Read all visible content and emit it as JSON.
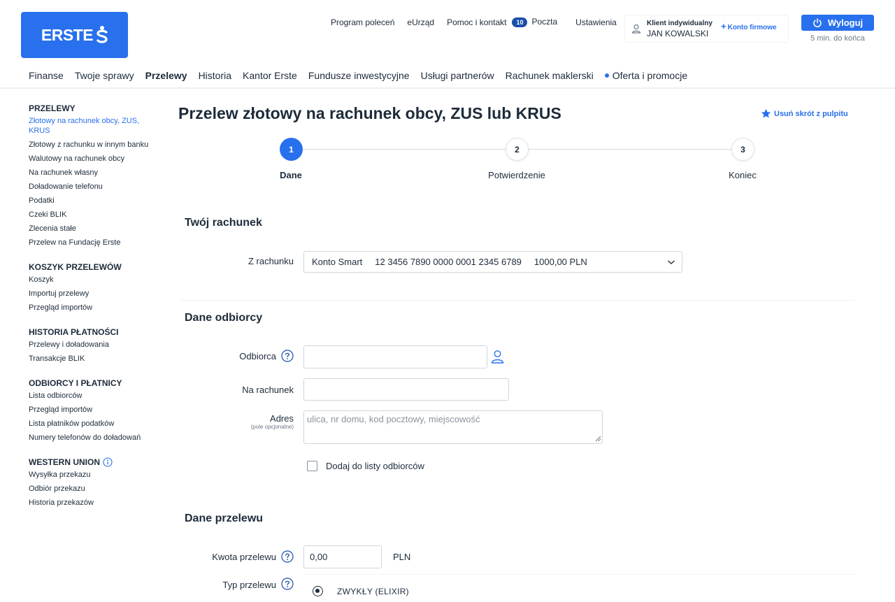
{
  "brand": {
    "name": "ERSTE",
    "color": "#2870ed"
  },
  "top_links": [
    {
      "label": "Program poleceń"
    },
    {
      "label": "eUrząd"
    },
    {
      "label": "Pomoc i kontakt"
    },
    {
      "label": "Poczta",
      "badge": "10"
    },
    {
      "label": "Ustawienia"
    }
  ],
  "client": {
    "type": "Klient indywidualny",
    "name": "JAN KOWALSKI",
    "business_link": "Konto firmowe"
  },
  "logout": {
    "label": "Wyloguj",
    "session_text": "5 min. do końca"
  },
  "main_nav": [
    {
      "label": "Finanse",
      "active": false
    },
    {
      "label": "Twoje sprawy",
      "active": false
    },
    {
      "label": "Przelewy",
      "active": true
    },
    {
      "label": "Historia",
      "active": false
    },
    {
      "label": "Kantor Erste",
      "active": false
    },
    {
      "label": "Fundusze inwestycyjne",
      "active": false
    },
    {
      "label": "Usługi partnerów",
      "active": false
    },
    {
      "label": "Rachunek maklerski",
      "active": false
    },
    {
      "label": "Oferta i promocje",
      "active": false
    }
  ],
  "sidebar": {
    "groups": [
      {
        "title": "PRZELEWY",
        "items": [
          {
            "label": "Złotowy na rachunek obcy, ZUS, KRUS",
            "active": true
          },
          {
            "label": "Złotowy z rachunku w innym banku"
          },
          {
            "label": "Walutowy na rachunek obcy"
          },
          {
            "label": "Na rachunek własny"
          },
          {
            "label": "Doładowanie telefonu"
          },
          {
            "label": "Podatki"
          },
          {
            "label": "Czeki BLIK"
          },
          {
            "label": "Zlecenia stałe"
          },
          {
            "label": "Przelew na Fundację Erste"
          }
        ]
      },
      {
        "title": "KOSZYK PRZELEWÓW",
        "items": [
          {
            "label": "Koszyk"
          },
          {
            "label": "Importuj przelewy"
          },
          {
            "label": "Przegląd importów"
          }
        ]
      },
      {
        "title": "HISTORIA PŁATNOŚCI",
        "items": [
          {
            "label": "Przelewy i doładowania"
          },
          {
            "label": "Transakcje BLIK"
          }
        ]
      },
      {
        "title": "ODBIORCY I PŁATNICY",
        "items": [
          {
            "label": "Lista odbiorców"
          },
          {
            "label": "Przegląd importów"
          },
          {
            "label": "Lista płatników podatków"
          },
          {
            "label": "Numery telefonów do doładowań"
          }
        ]
      },
      {
        "title": "WESTERN UNION",
        "info_icon": "info-circle-icon",
        "items": [
          {
            "label": "Wysyłka przekazu"
          },
          {
            "label": "Odbiór przekazu"
          },
          {
            "label": "Historia przekazów"
          }
        ]
      }
    ]
  },
  "page": {
    "title": "Przelew złotowy na rachunek obcy, ZUS lub KRUS",
    "shortcut_label": "Usuń skrót z pulpitu"
  },
  "stepper": [
    {
      "number": "1",
      "label": "Dane",
      "active": true
    },
    {
      "number": "2",
      "label": "Potwierdzenie",
      "active": false
    },
    {
      "number": "3",
      "label": "Koniec",
      "active": false
    }
  ],
  "sections": {
    "account": {
      "title": "Twój rachunek",
      "from_label": "Z rachunku",
      "account_name": "Konto Smart",
      "account_number": "12 3456 7890 0000 0001 2345 6789",
      "balance": "1000,00 PLN"
    },
    "recipient": {
      "title": "Dane odbiorcy",
      "recipient_label": "Odbiorca",
      "recipient_value": "",
      "account_label": "Na rachunek",
      "account_value": "",
      "address_label": "Adres",
      "address_note": "(pole opcjonalne)",
      "address_placeholder": "ulica, nr domu, kod pocztowy, miejscowość",
      "add_to_list_label": "Dodaj do listy odbiorców",
      "add_to_list_checked": false
    },
    "transfer": {
      "title": "Dane przelewu",
      "amount_label": "Kwota przelewu",
      "amount_value": "0,00",
      "currency": "PLN",
      "type_label": "Typ przelewu",
      "type_options": [
        {
          "label": "ZWYKŁY (ELIXIR)",
          "selected": true
        }
      ]
    }
  }
}
